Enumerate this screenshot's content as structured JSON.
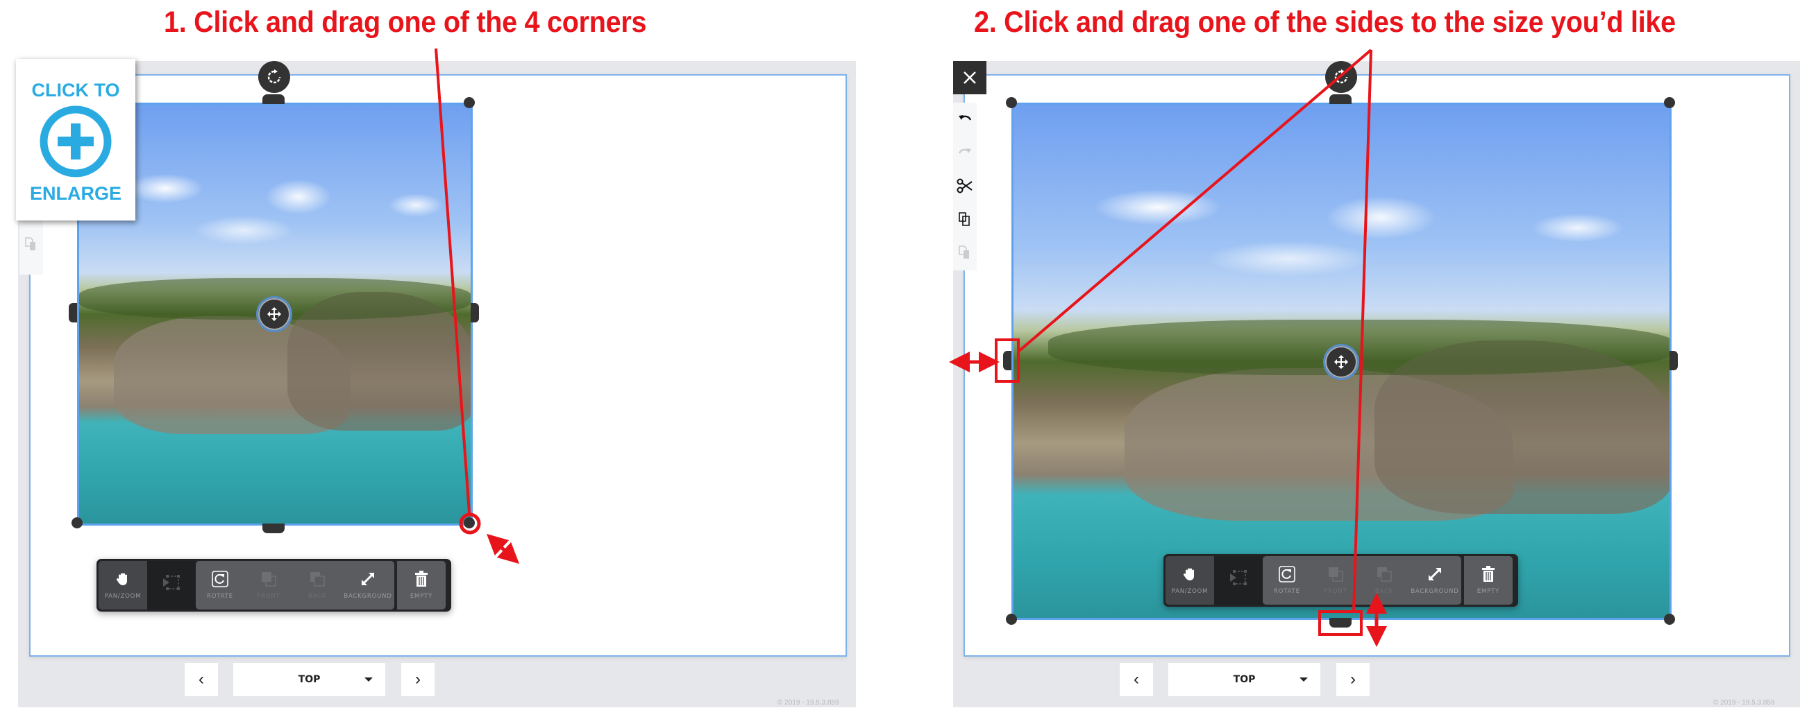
{
  "annotations": {
    "step1": "1. Click and drag one of the 4 corners",
    "step2": "2. Click and drag one of the sides to the size you’d like",
    "annotation_color": "#e8141b"
  },
  "enlarge_badge": {
    "line1": "CLICK TO",
    "line2": "ENLARGE",
    "icon": "plus-circle-icon",
    "color": "#29abe2"
  },
  "editor": {
    "accent_color": "#5fa3ee",
    "toolbar": [
      {
        "id": "pan-zoom",
        "label": "PAN/ZOOM",
        "icon": "hand-icon",
        "enabled": true
      },
      {
        "id": "select",
        "label": "",
        "icon": "select-icon",
        "enabled": true,
        "active": true
      },
      {
        "id": "rotate",
        "label": "ROTATE",
        "icon": "rotate-icon",
        "enabled": true
      },
      {
        "id": "front",
        "label": "FRONT",
        "icon": "bring-front-icon",
        "enabled": false
      },
      {
        "id": "back",
        "label": "BACK",
        "icon": "send-back-icon",
        "enabled": false
      },
      {
        "id": "background",
        "label": "BACKGROUND",
        "icon": "expand-icon",
        "enabled": true
      },
      {
        "id": "empty",
        "label": "EMPTY",
        "icon": "trash-icon",
        "enabled": true
      }
    ],
    "side_tools": [
      {
        "id": "undo",
        "icon": "undo-icon",
        "enabled": true
      },
      {
        "id": "redo",
        "icon": "redo-icon",
        "enabled": false
      },
      {
        "id": "cut",
        "icon": "scissors-icon",
        "enabled": true
      },
      {
        "id": "copy",
        "icon": "copy-icon",
        "enabled": true
      },
      {
        "id": "paste",
        "icon": "paste-icon",
        "enabled": false
      }
    ],
    "nav": {
      "prev": "‹",
      "next": "›",
      "view_selected": "TOP"
    },
    "copyright": "© 2019 - 19.5.3.859"
  }
}
